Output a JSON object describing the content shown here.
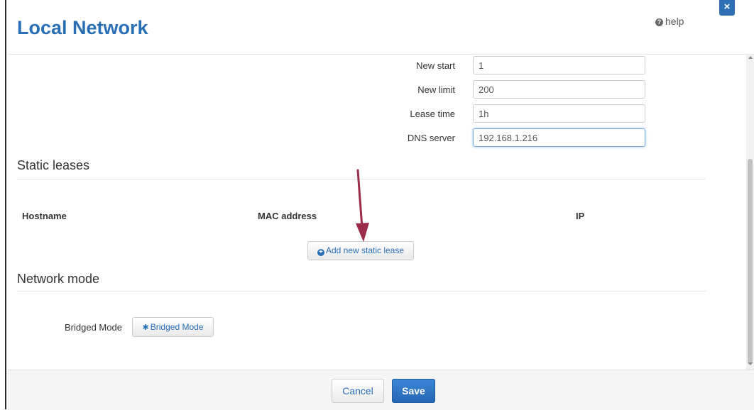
{
  "header": {
    "title": "Local Network",
    "help_label": "help"
  },
  "dhcp": {
    "fields": [
      {
        "label": "New start",
        "value": "1"
      },
      {
        "label": "New limit",
        "value": "200"
      },
      {
        "label": "Lease time",
        "value": "1h"
      },
      {
        "label": "DNS server",
        "value": "192.168.1.216"
      }
    ]
  },
  "static_leases": {
    "title": "Static leases",
    "columns": [
      "Hostname",
      "MAC address",
      "IP"
    ],
    "add_button_label": "Add new static lease"
  },
  "network_mode": {
    "title": "Network mode",
    "bridged_label": "Bridged Mode",
    "bridged_button_label": "Bridged Mode"
  },
  "footer": {
    "cancel_label": "Cancel",
    "save_label": "Save"
  },
  "colors": {
    "accent": "#2a6fb5",
    "arrow": "#9b2d4a"
  },
  "icons": [
    "help-icon",
    "close-icon",
    "plus-circle-icon",
    "gear-icon"
  ]
}
